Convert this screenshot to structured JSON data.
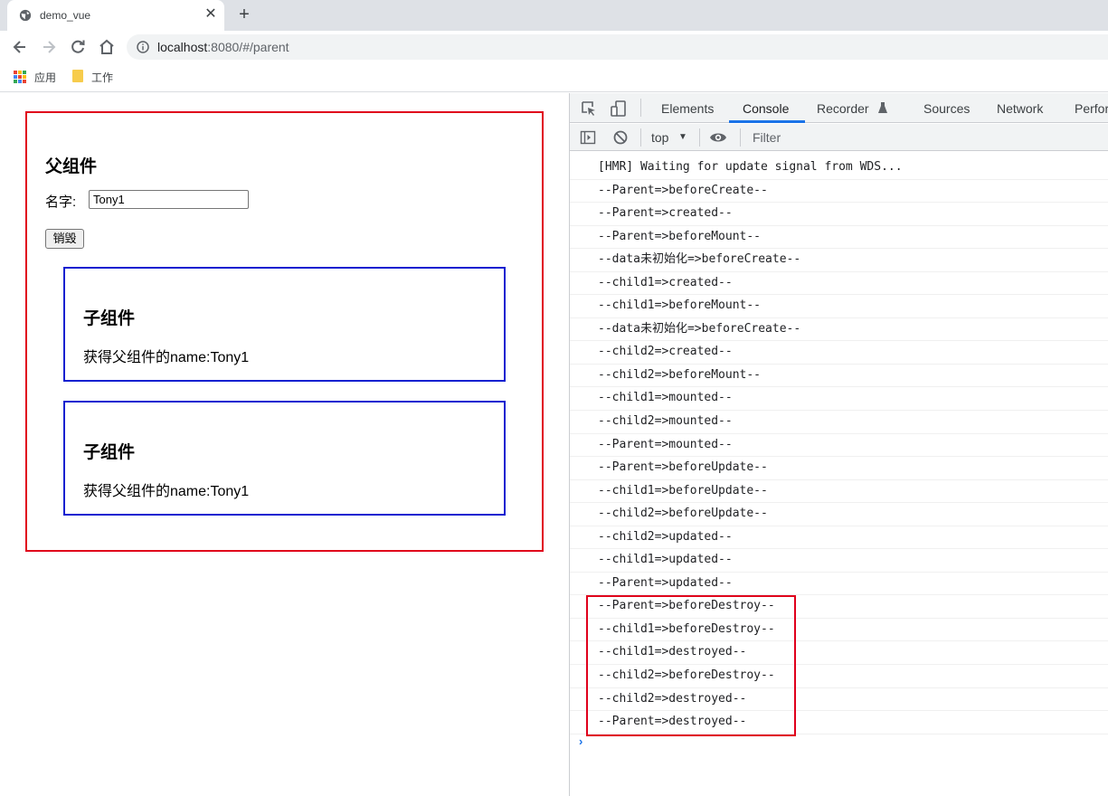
{
  "browser": {
    "tab_title": "demo_vue",
    "tab_close": "✕",
    "new_tab": "+",
    "url_host": "localhost",
    "url_rest": ":8080/#/parent",
    "bookmarks": [
      {
        "label": "应用",
        "icon": "apps-grid-icon"
      },
      {
        "label": "工作",
        "icon": "folder-icon"
      }
    ]
  },
  "page": {
    "parent_title": "父组件",
    "name_label": "名字:",
    "name_value": "Tony1",
    "destroy_button": "销毁",
    "children": [
      {
        "title": "子组件",
        "text": "获得父组件的name:Tony1"
      },
      {
        "title": "子组件",
        "text": "获得父组件的name:Tony1"
      }
    ],
    "parent_border_color": "#e0001b",
    "child_border_color": "#1020d0"
  },
  "devtools": {
    "tabs": [
      {
        "label": "Elements",
        "active": false
      },
      {
        "label": "Console",
        "active": true
      },
      {
        "label": "Recorder",
        "active": false
      },
      {
        "label": "Sources",
        "active": false
      },
      {
        "label": "Network",
        "active": false
      },
      {
        "label": "Perfor",
        "active": false
      }
    ],
    "context": "top",
    "filter_placeholder": "Filter",
    "console_lines": [
      "[HMR] Waiting for update signal from WDS...",
      "--Parent=>beforeCreate--",
      "--Parent=>created--",
      "--Parent=>beforeMount--",
      "--data未初始化=>beforeCreate--",
      "--child1=>created--",
      "--child1=>beforeMount--",
      "--data未初始化=>beforeCreate--",
      "--child2=>created--",
      "--child2=>beforeMount--",
      "--child1=>mounted--",
      "--child2=>mounted--",
      "--Parent=>mounted--",
      "--Parent=>beforeUpdate--",
      "--child1=>beforeUpdate--",
      "--child2=>beforeUpdate--",
      "--child2=>updated--",
      "--child1=>updated--",
      "--Parent=>updated--",
      "--Parent=>beforeDestroy--",
      "--child1=>beforeDestroy--",
      "--child1=>destroyed--",
      "--child2=>beforeDestroy--",
      "--child2=>destroyed--",
      "--Parent=>destroyed--"
    ],
    "prompt_symbol": "›",
    "accent_color": "#1a73e8"
  }
}
